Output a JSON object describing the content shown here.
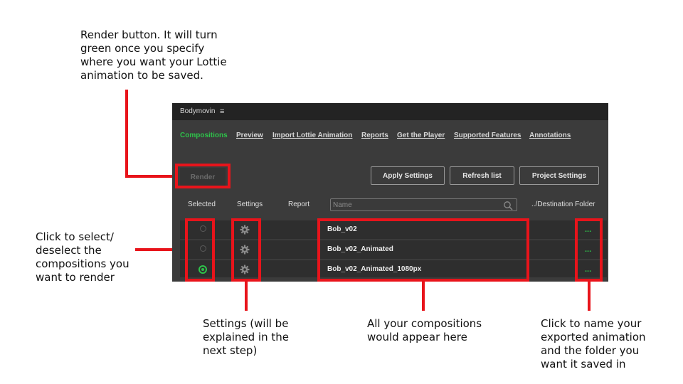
{
  "annotations": {
    "render": "Render button. It will turn\ngreen once you specify\nwhere you want your Lottie\nanimation to be saved.",
    "select": "Click to select/\ndeselect the\ncompositions you\nwant to render",
    "settings": "Settings (will be\nexplained in the\nnext step)",
    "compositions": "All your compositions\nwould appear here",
    "folder": "Click to name your\nexported animation\nand the folder you\nwant it saved in"
  },
  "app": {
    "title": "Bodymovin",
    "menu_icon": "hamburger-menu-icon",
    "tabs": [
      {
        "label": "Compositions",
        "active": true
      },
      {
        "label": "Preview"
      },
      {
        "label": "Import Lottie Animation"
      },
      {
        "label": "Reports"
      },
      {
        "label": "Get the Player"
      },
      {
        "label": "Supported Features"
      },
      {
        "label": "Annotations"
      }
    ],
    "render_label": "Render",
    "apply_label": "Apply Settings",
    "refresh_label": "Refresh list",
    "project_label": "Project Settings",
    "headers": {
      "selected": "Selected",
      "settings": "Settings",
      "report": "Report",
      "destination": "../Destination Folder"
    },
    "search_placeholder": "Name",
    "compositions": [
      {
        "name": "Bob_v02",
        "selected": false
      },
      {
        "name": "Bob_v02_Animated",
        "selected": false
      },
      {
        "name": "Bob_v02_Animated_1080px",
        "selected": true
      }
    ],
    "dots": "...",
    "colors": {
      "accent": "#2ec24a",
      "highlight": "#e8141b",
      "panel": "#3b3b3b"
    }
  }
}
